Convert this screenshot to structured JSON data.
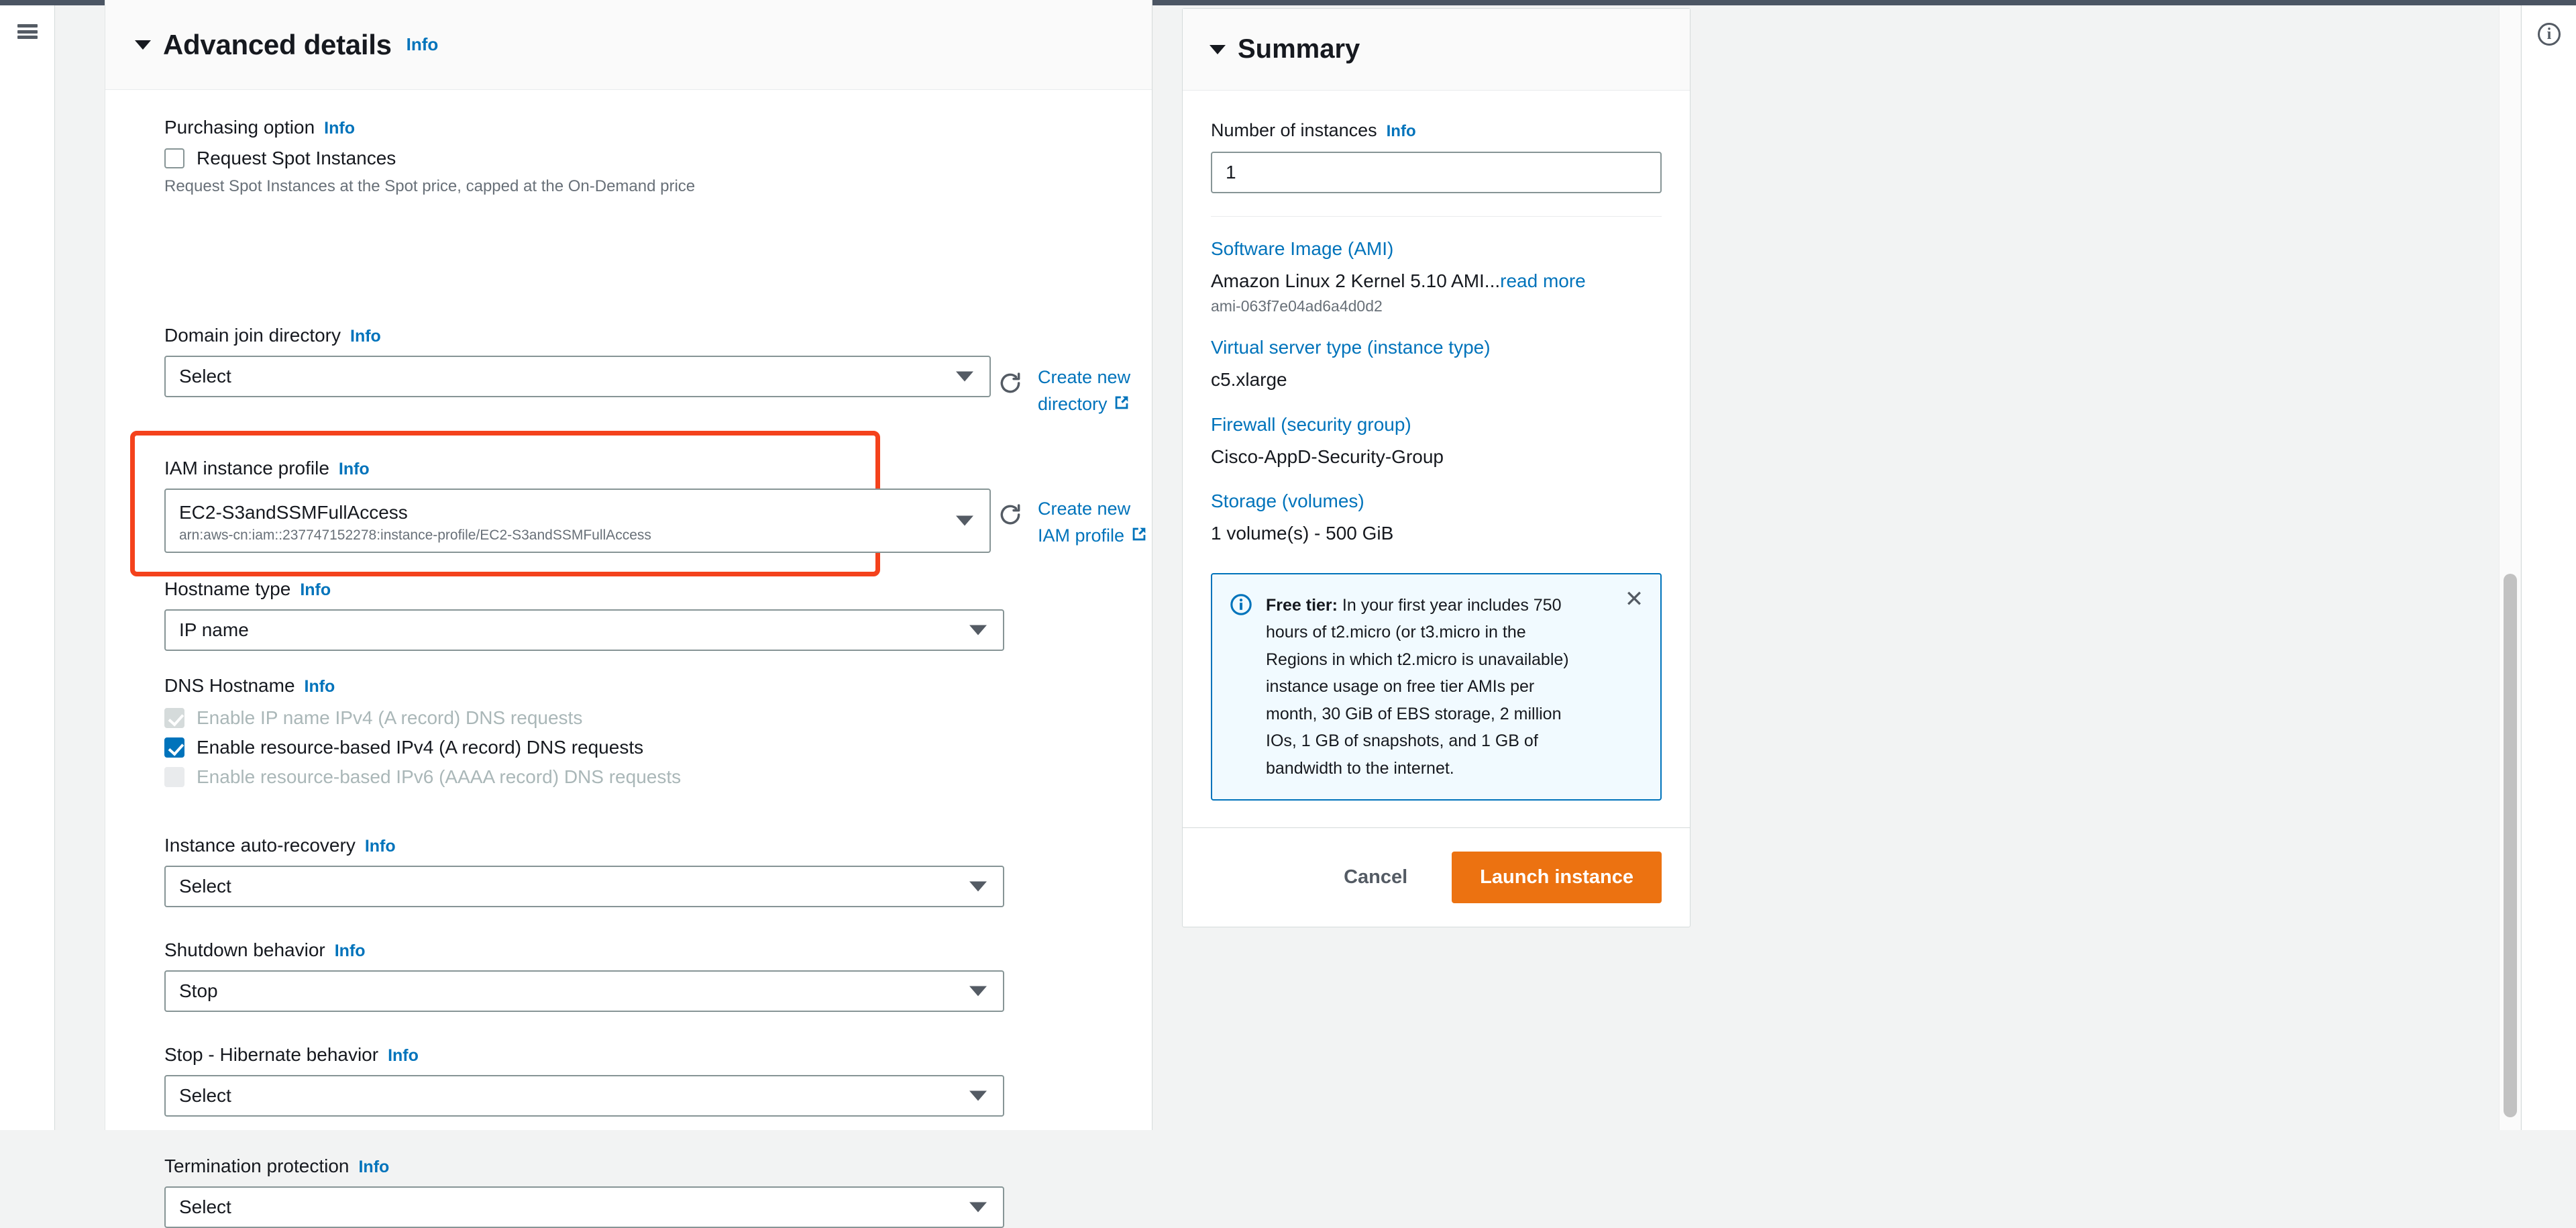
{
  "window": {
    "menu_icon": "hamburger-icon",
    "help_icon": "info-circle-icon"
  },
  "advanced_details": {
    "title": "Advanced details",
    "info_label": "Info",
    "purchasing_option": {
      "label": "Purchasing option",
      "info_label": "Info",
      "checkbox_label": "Request Spot Instances",
      "checked": false,
      "help_text": "Request Spot Instances at the Spot price, capped at the On-Demand price"
    },
    "domain_join_directory": {
      "label": "Domain join directory",
      "info_label": "Info",
      "value": "Select",
      "side_link": "Create new directory",
      "refresh_icon": "refresh-icon",
      "external_icon": "external-link-icon"
    },
    "iam_instance_profile": {
      "label": "IAM instance profile",
      "info_label": "Info",
      "value": "EC2-S3andSSMFullAccess",
      "value_arn": "arn:aws-cn:iam::237747152278:instance-profile/EC2-S3andSSMFullAccess",
      "side_link": "Create new IAM profile",
      "refresh_icon": "refresh-icon",
      "external_icon": "external-link-icon",
      "highlight_color": "#f4421c"
    },
    "hostname_type": {
      "label": "Hostname type",
      "info_label": "Info",
      "value": "IP name"
    },
    "dns_hostname": {
      "label": "DNS Hostname",
      "info_label": "Info",
      "options": [
        {
          "label": "Enable IP name IPv4 (A record) DNS requests",
          "checked": true,
          "disabled": true
        },
        {
          "label": "Enable resource-based IPv4 (A record) DNS requests",
          "checked": true,
          "disabled": false
        },
        {
          "label": "Enable resource-based IPv6 (AAAA record) DNS requests",
          "checked": false,
          "disabled": true
        }
      ]
    },
    "instance_auto_recovery": {
      "label": "Instance auto-recovery",
      "info_label": "Info",
      "value": "Select"
    },
    "shutdown_behavior": {
      "label": "Shutdown behavior",
      "info_label": "Info",
      "value": "Stop"
    },
    "stop_hibernate_behavior": {
      "label": "Stop - Hibernate behavior",
      "info_label": "Info",
      "value": "Select"
    },
    "termination_protection": {
      "label": "Termination protection",
      "info_label": "Info",
      "value": "Select"
    }
  },
  "summary": {
    "title": "Summary",
    "number_of_instances": {
      "label": "Number of instances",
      "info_label": "Info",
      "value": "1"
    },
    "groups": [
      {
        "link": "Software Image (AMI)",
        "value": "Amazon Linux 2 Kernel 5.10 AMI...",
        "value_link": "read more",
        "sub": "ami-063f7e04ad6a4d0d2"
      },
      {
        "link": "Virtual server type (instance type)",
        "value": "c5.xlarge"
      },
      {
        "link": "Firewall (security group)",
        "value": "Cisco-AppD-Security-Group"
      },
      {
        "link": "Storage (volumes)",
        "value": "1 volume(s) - 500 GiB"
      }
    ],
    "free_tier_alert": {
      "icon": "info-icon",
      "title": "Free tier:",
      "body": " In your first year includes 750 hours of t2.micro (or t3.micro in the Regions in which t2.micro is unavailable) instance usage on free tier AMIs per month, 30 GiB of EBS storage, 2 million IOs, 1 GB of snapshots, and 1 GB of bandwidth to the internet.",
      "close_icon": "close-icon"
    },
    "cancel_label": "Cancel",
    "launch_label": "Launch instance",
    "launch_color": "#ec7211"
  }
}
